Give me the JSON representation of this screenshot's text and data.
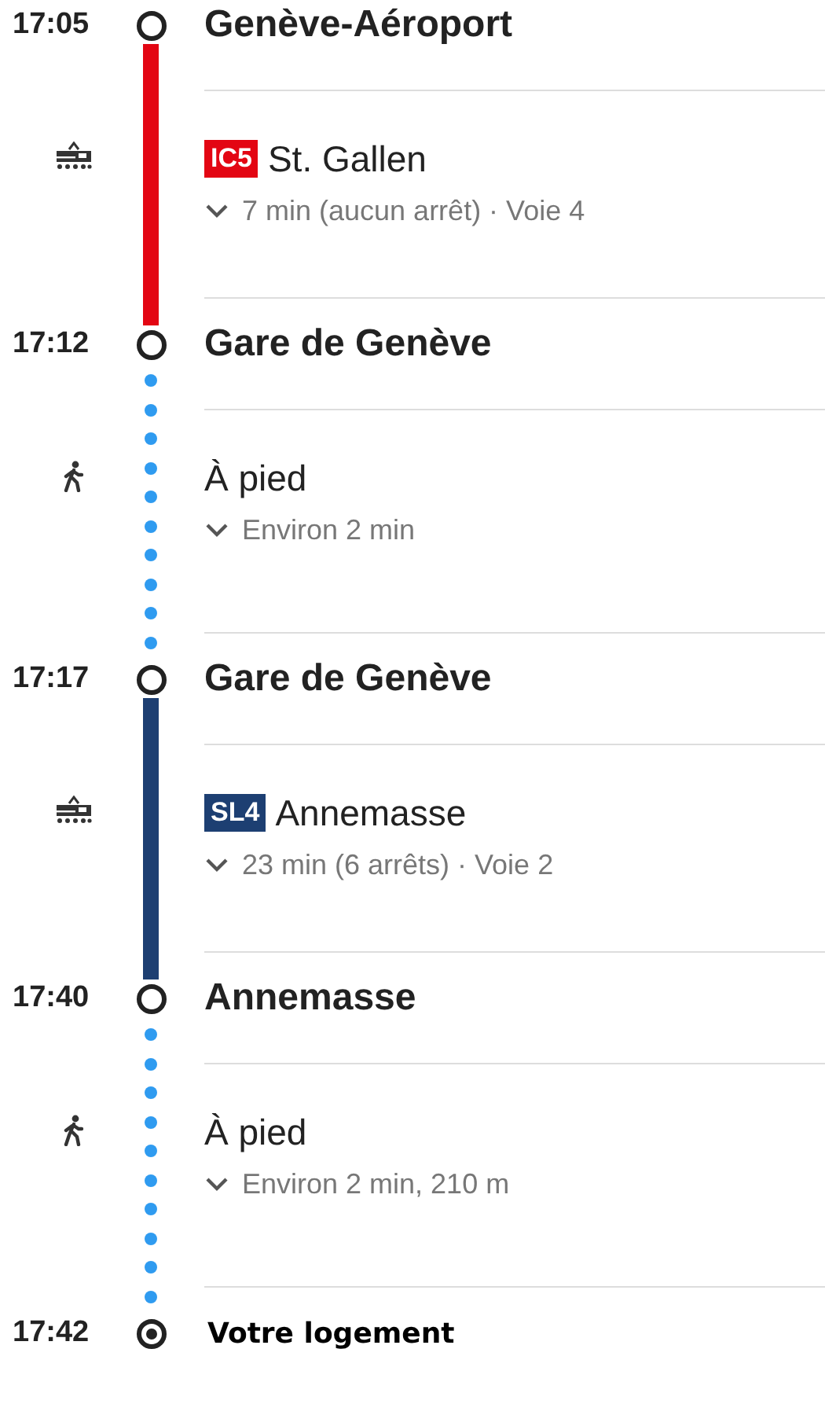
{
  "itinerary": [
    {
      "kind": "stop",
      "time": "17:05",
      "name": "Genève-Aéroport"
    },
    {
      "kind": "transit",
      "color": "#e30613",
      "line": "IC5",
      "destination": "St. Gallen",
      "details": "7 min (aucun arrêt) · Voie 4"
    },
    {
      "kind": "stop",
      "time": "17:12",
      "name": "Gare de Genève"
    },
    {
      "kind": "walk",
      "title": "À pied",
      "details": "Environ 2 min"
    },
    {
      "kind": "stop",
      "time": "17:17",
      "name": "Gare de Genève"
    },
    {
      "kind": "transit",
      "color": "#1d3f72",
      "line": "SL4",
      "destination": "Annemasse",
      "details": "23 min (6 arrêts) · Voie 2"
    },
    {
      "kind": "stop",
      "time": "17:40",
      "name": "Annemasse"
    },
    {
      "kind": "walk",
      "title": "À pied",
      "details": "Environ 2 min, 210 m"
    },
    {
      "kind": "destination",
      "time": "17:42",
      "name": "Votre logement"
    }
  ]
}
